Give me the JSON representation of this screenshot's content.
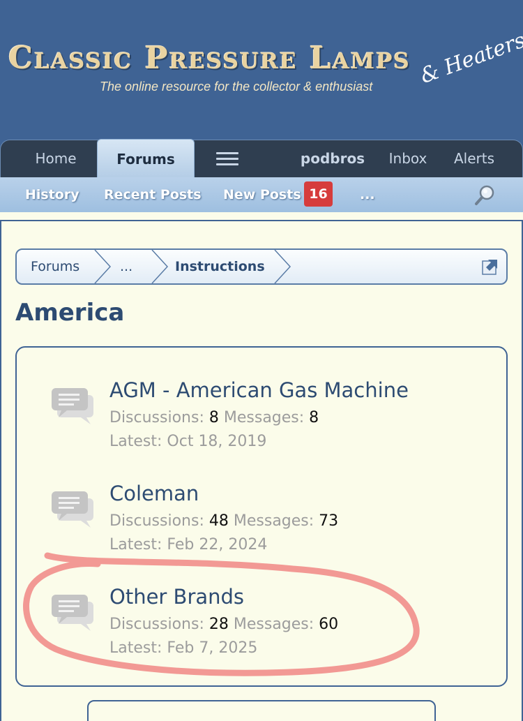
{
  "header": {
    "logo_title": "Classic Pressure Lamps",
    "logo_tagline": "The online resource for the collector & enthusiast",
    "logo_script": "& Heaters"
  },
  "nav": {
    "tabs": [
      {
        "label": "Home"
      },
      {
        "label": "Forums"
      },
      {
        "label": "podbros"
      },
      {
        "label": "Inbox"
      },
      {
        "label": "Alerts"
      }
    ],
    "menu_icon": "hamburger-menu-icon"
  },
  "subnav": {
    "items": [
      {
        "label": "History"
      },
      {
        "label": "Recent Posts"
      },
      {
        "label": "New Posts"
      },
      {
        "label": "..."
      }
    ],
    "new_posts_count": "16",
    "search_icon": "search-icon"
  },
  "breadcrumb": {
    "items": [
      {
        "label": "Forums"
      },
      {
        "label": "..."
      },
      {
        "label": "Instructions"
      }
    ]
  },
  "page": {
    "title": "America"
  },
  "stats_labels": {
    "discussions": "Discussions:",
    "messages": "Messages:",
    "latest": "Latest:"
  },
  "nodes": [
    {
      "title": "AGM - American Gas Machine",
      "discussions": "8",
      "messages": "8",
      "latest": "Oct 18, 2019"
    },
    {
      "title": "Coleman",
      "discussions": "48",
      "messages": "73",
      "latest": "Feb 22, 2024"
    },
    {
      "title": "Other Brands",
      "discussions": "28",
      "messages": "60",
      "latest": "Feb 7, 2025"
    }
  ],
  "colors": {
    "header_bg": "#3f6394",
    "nav_dark": "#2f3e50",
    "link_blue": "#2d4b72",
    "badge_red": "#d63c3c",
    "annotation_red": "#ee6f6f",
    "page_bg": "#fbfcea"
  }
}
